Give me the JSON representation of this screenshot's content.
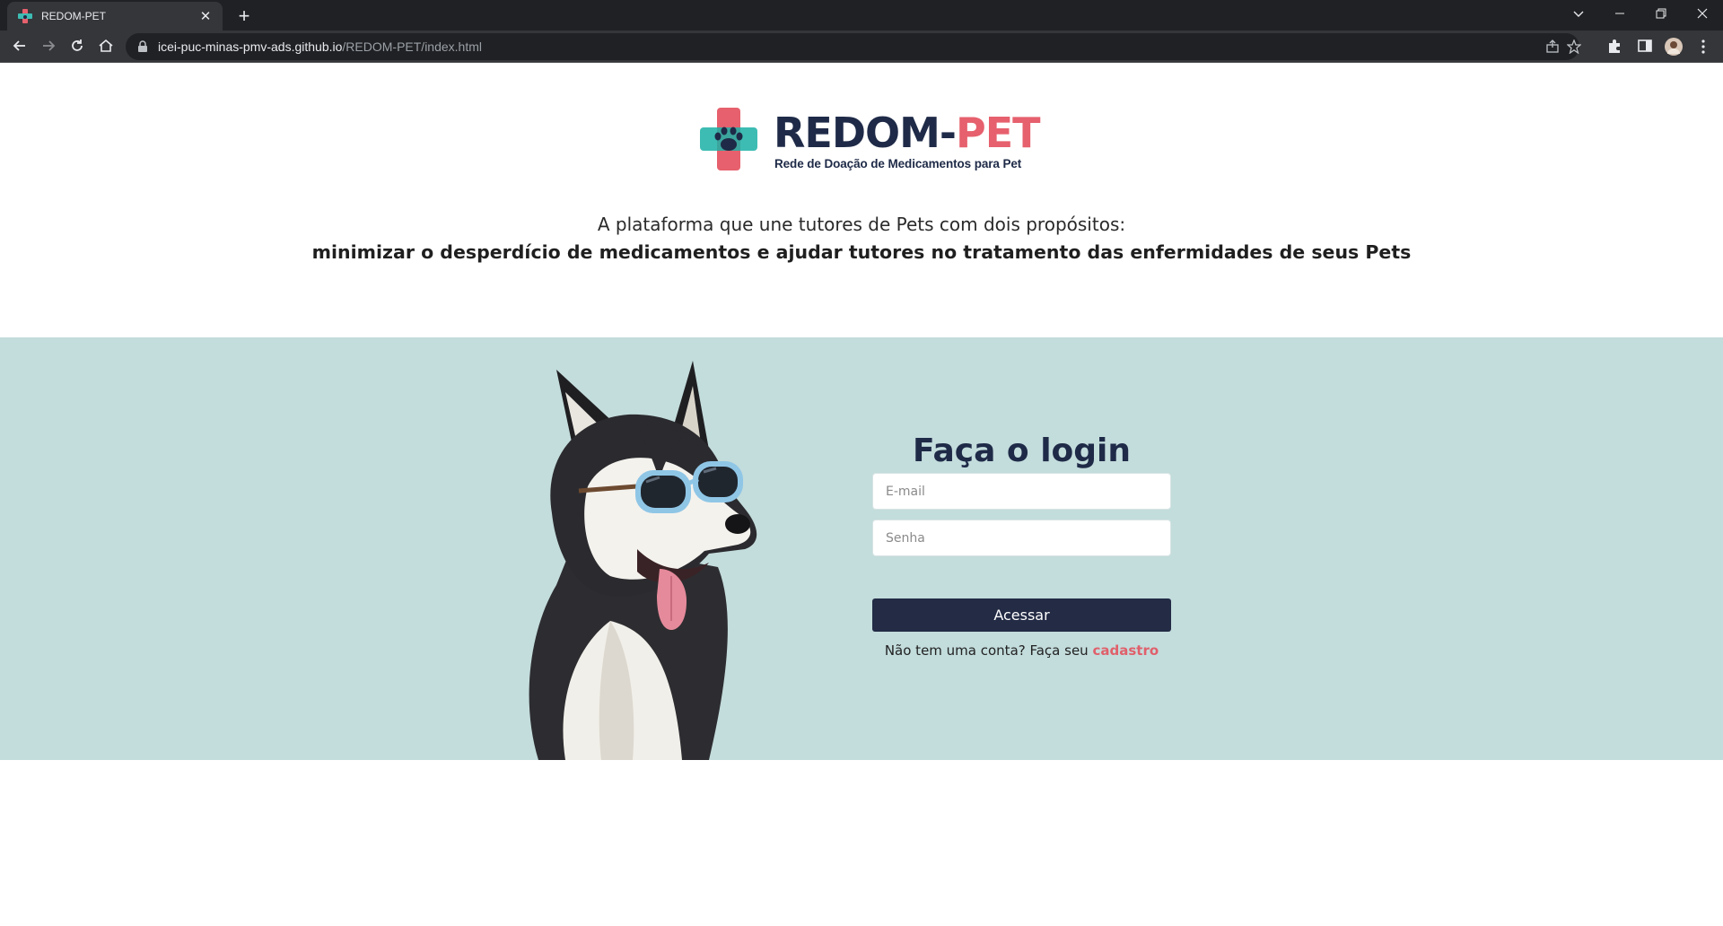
{
  "browser": {
    "tab_title": "REDOM-PET",
    "new_tab_symbol": "+",
    "close_tab_symbol": "✕",
    "url_host": "icei-puc-minas-pmv-ads.github.io",
    "url_path": "/REDOM-PET/index.html",
    "icons": [
      "back-arrow-icon",
      "forward-arrow-icon",
      "reload-icon",
      "home-icon",
      "lock-icon",
      "share-icon",
      "star-icon",
      "extensions-icon",
      "side-panel-icon",
      "profile-avatar",
      "menu-kebab-icon",
      "tab-search-icon",
      "minimize-icon",
      "restore-icon",
      "close-window-icon"
    ]
  },
  "header": {
    "logo_word_1": "REDOM-",
    "logo_word_2": "PET",
    "logo_subtitle": "Rede de Doação de Medicamentos para Pet",
    "tagline_line1": "A plataforma que une tutores de Pets com dois propósitos:",
    "tagline_line2": "minimizar o desperdício de medicamentos e ajudar tutores no tratamento das enfermidades de seus Pets"
  },
  "login": {
    "title": "Faça o login",
    "email_placeholder": "E-mail",
    "password_placeholder": "Senha",
    "submit_label": "Acessar",
    "signup_prompt": "Não tem uma conta? Faça seu ",
    "signup_link": "cadastro"
  },
  "colors": {
    "brand_navy": "#1e2a47",
    "brand_pink": "#e6606d",
    "brand_teal": "#3dbcb3",
    "hero_background": "#c3dcdc",
    "button_background": "#232b45"
  }
}
